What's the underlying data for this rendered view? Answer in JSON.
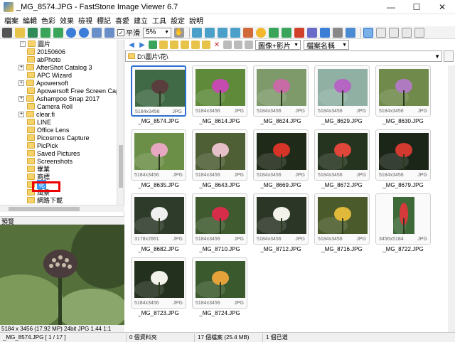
{
  "window": {
    "title": "_MG_8574.JPG - FastStone Image Viewer 6.7",
    "minimize": "—",
    "maximize": "☐",
    "close": "✕"
  },
  "menu": [
    "檔案",
    "編輯",
    "色彩",
    "效果",
    "檢視",
    "標記",
    "喜愛",
    "建立",
    "工具",
    "設定",
    "說明"
  ],
  "toolbar": {
    "smooth_label": "平滑",
    "smooth_checked": "✓",
    "zoom_value": "5%"
  },
  "browser_toolbar": {
    "view_mode": "圖像+影片",
    "sort_mode": "檔案名稱"
  },
  "address": {
    "path": "D:\\圖片\\花\\"
  },
  "tree": {
    "items": [
      {
        "label": "圖片",
        "level": 1,
        "expander": "-"
      },
      {
        "label": "20150606",
        "level": 2,
        "expander": ""
      },
      {
        "label": "abPhoto",
        "level": 2,
        "expander": ""
      },
      {
        "label": "AfterShot Catalog 3",
        "level": 2,
        "expander": "+"
      },
      {
        "label": "APC Wizard",
        "level": 2,
        "expander": ""
      },
      {
        "label": "Apowersoft",
        "level": 2,
        "expander": "+"
      },
      {
        "label": "Apowersoft Free Screen Capture",
        "level": 2,
        "expander": ""
      },
      {
        "label": "Ashampoo Snap 2017",
        "level": 2,
        "expander": "+"
      },
      {
        "label": "Camera Roll",
        "level": 2,
        "expander": ""
      },
      {
        "label": "clear.fi",
        "level": 2,
        "expander": "+"
      },
      {
        "label": "LINE",
        "level": 2,
        "expander": ""
      },
      {
        "label": "Office Lens",
        "level": 2,
        "expander": ""
      },
      {
        "label": "Picosmos Capture",
        "level": 2,
        "expander": ""
      },
      {
        "label": "PicPick",
        "level": 2,
        "expander": ""
      },
      {
        "label": "Saved Pictures",
        "level": 2,
        "expander": ""
      },
      {
        "label": "Screenshots",
        "level": 2,
        "expander": ""
      },
      {
        "label": "畢業",
        "level": 2,
        "expander": ""
      },
      {
        "label": "商標",
        "level": 2,
        "expander": ""
      },
      {
        "label": "花",
        "level": 2,
        "expander": "",
        "selected": true
      },
      {
        "label": "風景",
        "level": 2,
        "expander": ""
      },
      {
        "label": "網路下載",
        "level": 2,
        "expander": ""
      }
    ]
  },
  "preview": {
    "label": "預覽",
    "info": "5184 x 3456 (17.92 MP)  24bit  JPG  1.44  1:1"
  },
  "thumbnails": [
    {
      "name": "_MG_8574.JPG",
      "dims": "5184x3456",
      "type": "JPG",
      "selected": true,
      "bg": "#3f6a45",
      "accent": "#5a3d3d"
    },
    {
      "name": "_MG_8614.JPG",
      "dims": "5184x3456",
      "type": "JPG",
      "bg": "#5e8a3a",
      "accent": "#c64bb0"
    },
    {
      "name": "_MG_8624.JPG",
      "dims": "5184x3456",
      "type": "JPG",
      "bg": "#7e9a6a",
      "accent": "#c86aa6"
    },
    {
      "name": "_MG_8629.JPG",
      "dims": "5184x3456",
      "type": "JPG",
      "bg": "#8fb0a2",
      "accent": "#b565c4"
    },
    {
      "name": "_MG_8630.JPG",
      "dims": "5184x3456",
      "type": "JPG",
      "bg": "#6f8a4a",
      "accent": "#b07ac0"
    },
    {
      "name": "_MG_8635.JPG",
      "dims": "5184x3456",
      "type": "JPG",
      "bg": "#6c8f48",
      "accent": "#e8a7c0"
    },
    {
      "name": "_MG_8643.JPG",
      "dims": "5184x3456",
      "type": "JPG",
      "bg": "#4e5e35",
      "accent": "#e6c0c8"
    },
    {
      "name": "_MG_8669.JPG",
      "dims": "5184x3456",
      "type": "JPG",
      "bg": "#1f2a18",
      "accent": "#d63428"
    },
    {
      "name": "_MG_8672.JPG",
      "dims": "5184x3456",
      "type": "JPG",
      "bg": "#24341e",
      "accent": "#e0463a"
    },
    {
      "name": "_MG_8679.JPG",
      "dims": "5184x3456",
      "type": "JPG",
      "bg": "#1c2618",
      "accent": "#d23a30"
    },
    {
      "name": "_MG_8682.JPG",
      "dims": "3178x2661",
      "type": "JPG",
      "bg": "#2e3a2a",
      "accent": "#f0f0f0"
    },
    {
      "name": "_MG_8710.JPG",
      "dims": "5184x3456",
      "type": "JPG",
      "bg": "#3e5a2e",
      "accent": "#d62e4a"
    },
    {
      "name": "_MG_8712.JPG",
      "dims": "5184x3456",
      "type": "JPG",
      "bg": "#2c3626",
      "accent": "#f2f2ea"
    },
    {
      "name": "_MG_8716.JPG",
      "dims": "5184x3456",
      "type": "JPG",
      "bg": "#4a5a2a",
      "accent": "#e0b83a"
    },
    {
      "name": "_MG_8722.JPG",
      "dims": "3456x5184",
      "type": "JPG",
      "bg": "#3e6a3a",
      "accent": "#d43a3a",
      "portrait": true
    },
    {
      "name": "_MG_8723.JPG",
      "dims": "5184x3456",
      "type": "JPG",
      "bg": "#24301e",
      "accent": "#f2f2ea"
    },
    {
      "name": "_MG_8724.JPG",
      "dims": "5184x3456",
      "type": "JPG",
      "bg": "#3a5a2e",
      "accent": "#e6a23a"
    }
  ],
  "status": {
    "file": "_MG_8574.JPG [ 1 / 17 ]",
    "folders": "0 個資料夾",
    "files": "17 個檔案 (25.4 MB)",
    "selected": "1 個已選"
  }
}
